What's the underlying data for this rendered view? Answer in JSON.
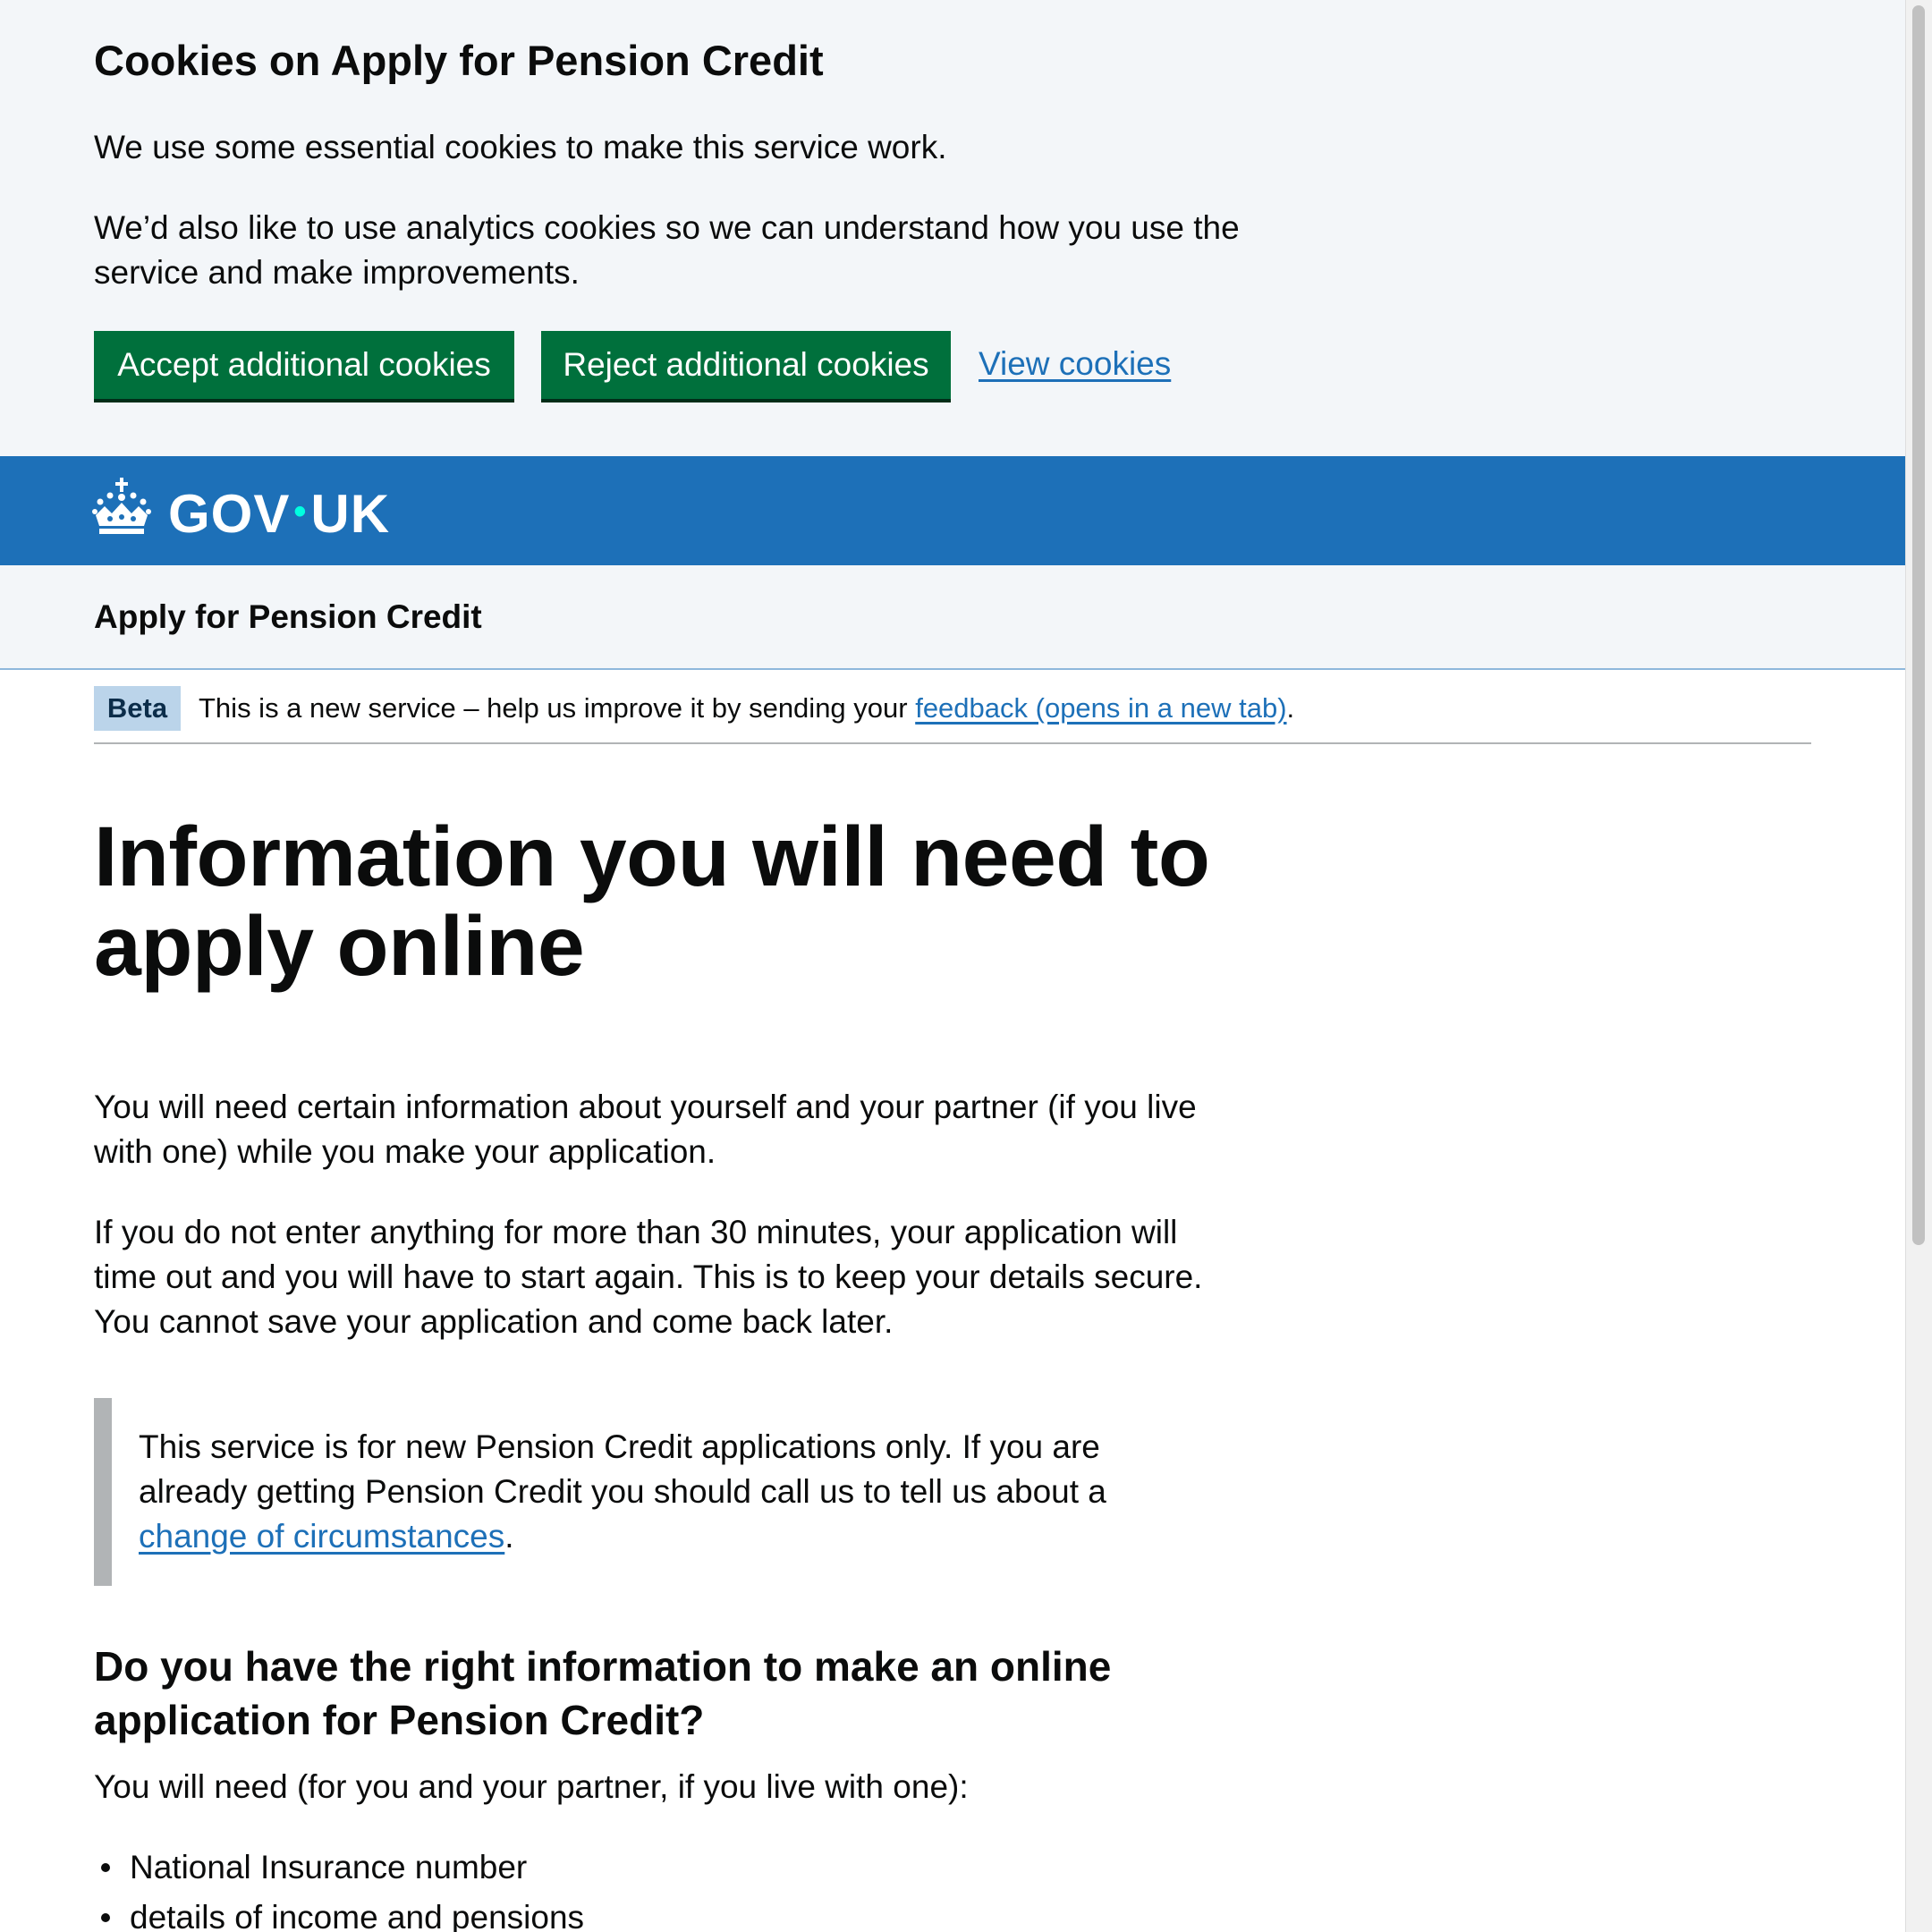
{
  "cookie_banner": {
    "title": "Cookies on Apply for Pension Credit",
    "p1": "We use some essential cookies to make this service work.",
    "p2": "We’d also like to use analytics cookies so we can understand how you use the service and make improvements.",
    "accept_label": "Accept additional cookies",
    "reject_label": "Reject additional cookies",
    "view_label": "View cookies"
  },
  "header": {
    "logo_left": "GOV",
    "logo_dot": "•",
    "logo_right": "UK",
    "crown_icon": "crown-icon"
  },
  "service": {
    "name": "Apply for Pension Credit"
  },
  "phase_banner": {
    "tag": "Beta",
    "text_before": "This is a new service – help us improve it by sending your ",
    "link": "feedback (opens in a new tab)",
    "text_after": "."
  },
  "main": {
    "title": "Information you will need to apply online",
    "p1": "You will need certain information about yourself and your partner (if you live with one) while you make your application.",
    "p2": "If you do not enter anything for more than 30 minutes, your application will time out and you will have to start again. This is to keep your details secure. You cannot save your application and come back later.",
    "inset_before": "This service is for new Pension Credit applications only. If you are already getting Pension Credit you should call us to tell us about a ",
    "inset_link": "change of circumstances",
    "inset_after": ".",
    "h2": "Do you have the right information to make an online application for Pension Credit?",
    "list_intro": "You will need (for you and your partner, if you live with one):",
    "list": [
      "National Insurance number",
      "details of income and pensions"
    ]
  },
  "colors": {
    "brand_blue": "#1d70b8",
    "button_green": "#00703c",
    "banner_bg": "#f3f6f9",
    "tag_bg": "#bbd4ea",
    "inset_border": "#b1b4b6"
  }
}
